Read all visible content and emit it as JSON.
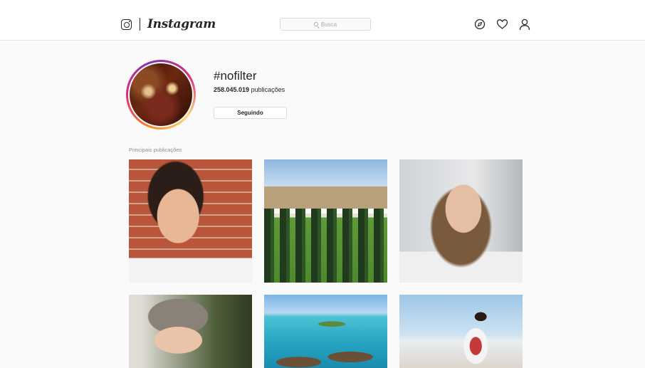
{
  "app": {
    "brand_name": "Instagram"
  },
  "search": {
    "placeholder": "Busca"
  },
  "nav": {
    "icons": [
      "compass-icon",
      "heart-icon",
      "profile-icon"
    ]
  },
  "hashtag": {
    "title": "#nofilter",
    "post_count": "258.045.019",
    "post_count_suffix": " publicações",
    "follow_label": "Seguindo"
  },
  "section": {
    "top_posts_label": "Principais publicações"
  },
  "posts": [
    {
      "alt": ""
    },
    {
      "alt": ""
    },
    {
      "alt": ""
    },
    {
      "alt": ""
    },
    {
      "alt": ""
    },
    {
      "alt": ""
    }
  ],
  "colors": {
    "text": "#262626",
    "muted": "#8e8e8e",
    "border": "#dbdbdb",
    "background": "#fafafa",
    "ring_gradient": [
      "#f58529",
      "#dd2a7b",
      "#8134af",
      "#feda77"
    ]
  }
}
